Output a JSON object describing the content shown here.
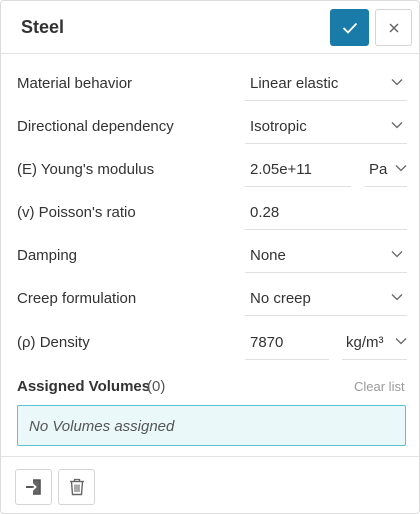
{
  "header": {
    "title": "Steel",
    "confirm_icon": "check-icon",
    "close_icon": "close-icon",
    "accent_color": "#1a7aa8"
  },
  "properties": [
    {
      "id": "material-behavior",
      "label": "Material behavior",
      "value": "Linear elastic",
      "type": "select"
    },
    {
      "id": "directional-dependency",
      "label": "Directional dependency",
      "value": "Isotropic",
      "type": "select"
    },
    {
      "id": "youngs-modulus",
      "label": "(E) Young's modulus",
      "value": "2.05e+11",
      "unit": "Pa",
      "type": "number-unit"
    },
    {
      "id": "poissons-ratio",
      "label": "(v) Poisson's ratio",
      "value": "0.28",
      "type": "number"
    },
    {
      "id": "damping",
      "label": "Damping",
      "value": "None",
      "type": "select"
    },
    {
      "id": "creep-formulation",
      "label": "Creep formulation",
      "value": "No creep",
      "type": "select"
    },
    {
      "id": "density",
      "label": "(ρ) Density",
      "value": "7870",
      "unit": "kg/m³",
      "type": "number-unit"
    }
  ],
  "assigned": {
    "title": "Assigned Volumes",
    "count": "(0)",
    "clear_label": "Clear list",
    "empty_text": "No Volumes assigned",
    "box_color": "#eaf8fa",
    "border_color": "#5cc3cd"
  },
  "footer": {
    "assign_icon": "assign-in-icon",
    "delete_icon": "trash-icon"
  }
}
